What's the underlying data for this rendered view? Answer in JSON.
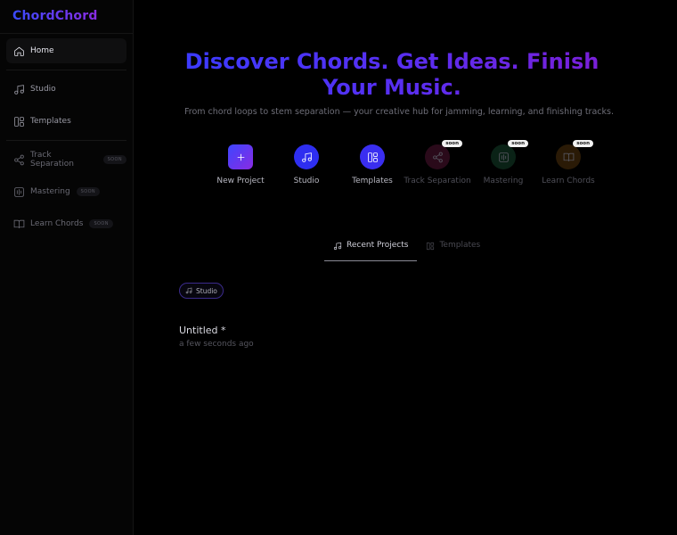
{
  "app": {
    "name": "ChordChord"
  },
  "sidebar": {
    "items": [
      {
        "label": "Home",
        "icon": "home-icon",
        "active": true
      },
      {
        "label": "Studio",
        "icon": "music-note-icon"
      },
      {
        "label": "Templates",
        "icon": "layout-icon"
      },
      {
        "label": "Track Separation",
        "icon": "split-icon",
        "soon": "SOON"
      },
      {
        "label": "Mastering",
        "icon": "mastering-icon",
        "soon": "SOON"
      },
      {
        "label": "Learn Chords",
        "icon": "book-icon",
        "soon": "SOON"
      }
    ]
  },
  "hero": {
    "title": "Discover Chords. Get Ideas. Finish Your Music.",
    "subtitle": "From chord loops to stem separation — your creative hub for jamming, learning, and finishing tracks."
  },
  "actions": [
    {
      "label": "New Project",
      "icon": "plus-icon",
      "color": "#5b3cf2"
    },
    {
      "label": "Studio",
      "icon": "music-note-icon",
      "color": "#2e2ef0"
    },
    {
      "label": "Templates",
      "icon": "layout-icon",
      "color": "#3a2ef0"
    },
    {
      "label": "Track Separation",
      "icon": "split-icon",
      "color": "#2a0a1a",
      "badge": "soon"
    },
    {
      "label": "Mastering",
      "icon": "mastering-icon",
      "color": "#0a2216",
      "badge": "soon"
    },
    {
      "label": "Learn Chords",
      "icon": "book-icon",
      "color": "#2a1a06",
      "badge": "soon"
    }
  ],
  "tabs": [
    {
      "label": "Recent Projects",
      "icon": "music-note-icon",
      "active": true
    },
    {
      "label": "Templates",
      "icon": "layout-icon",
      "active": false
    }
  ],
  "project": {
    "chip": "Studio",
    "name": "Untitled *",
    "time": "a few seconds ago"
  }
}
